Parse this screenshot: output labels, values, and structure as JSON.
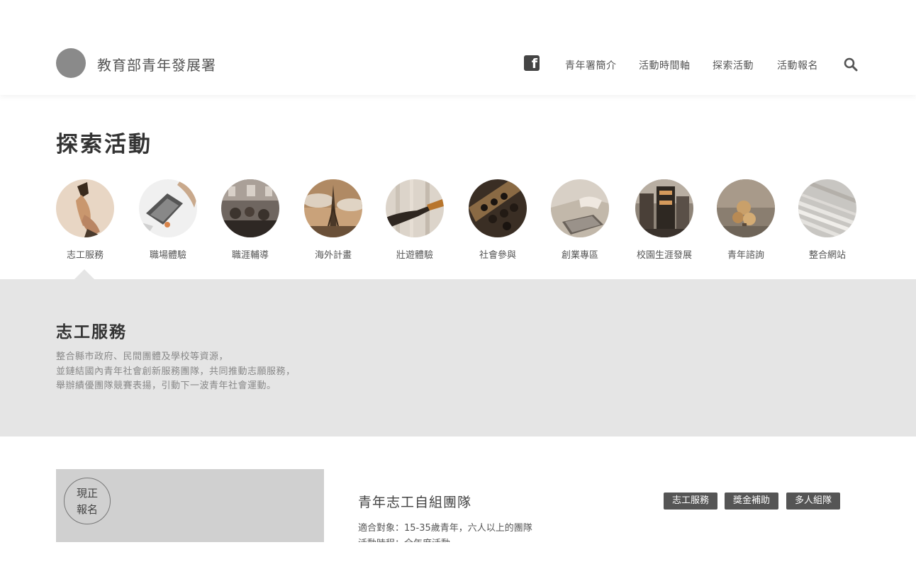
{
  "header": {
    "site_title": "教育部青年發展署",
    "facebook_icon": "facebook-icon",
    "nav": [
      "青年署簡介",
      "活動時間軸",
      "探索活動",
      "活動報名"
    ],
    "search_icon": "search-icon"
  },
  "page_title": "探索活動",
  "categories": [
    {
      "label": "志工服務",
      "selected": true
    },
    {
      "label": "職場體驗"
    },
    {
      "label": "職涯輔導"
    },
    {
      "label": "海外計畫"
    },
    {
      "label": "壯遊體驗"
    },
    {
      "label": "社會參與"
    },
    {
      "label": "創業專區"
    },
    {
      "label": "校園生涯發展"
    },
    {
      "label": "青年諮詢"
    },
    {
      "label": "整合網站"
    }
  ],
  "panel": {
    "title": "志工服務",
    "lines": [
      "整合縣市政府、民間團體及學校等資源，",
      "並鏈結國內青年社會創新服務團隊，共同推動志願服務，",
      "舉辦績優團隊競賽表揚，引動下一波青年社會運動。"
    ]
  },
  "card": {
    "badge_line1": "現正",
    "badge_line2": "報名",
    "title": "青年志工自組團隊",
    "audience": "適合對象：15-35歲青年，六人以上的團隊",
    "period": "活動時程：全年度活動",
    "tags": [
      "志工服務",
      "獎金補助",
      "多人組隊"
    ]
  },
  "colors": {
    "panel_bg": "#e5e5e5",
    "tag_bg": "#555555",
    "logo": "#8a8a8a"
  }
}
